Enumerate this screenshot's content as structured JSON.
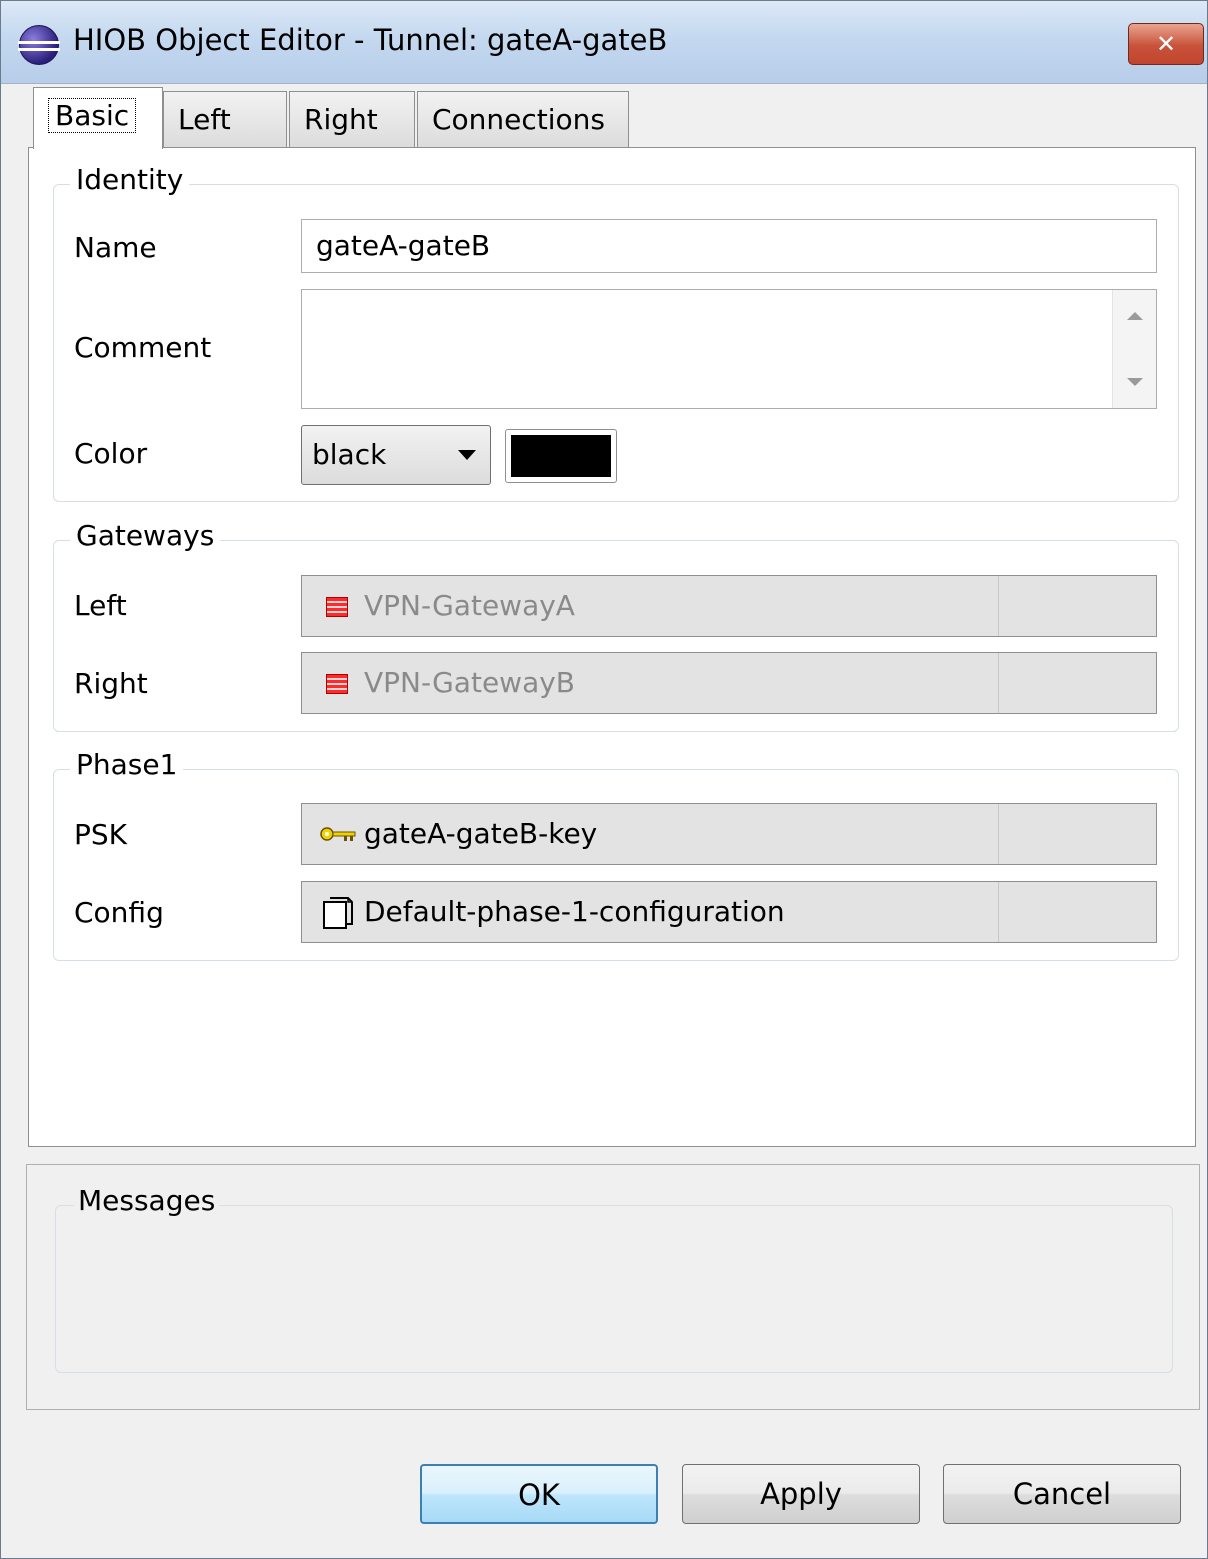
{
  "window": {
    "title": "HIOB Object Editor - Tunnel: gateA-gateB",
    "close_label": "✕"
  },
  "tabs": [
    {
      "label": "Basic",
      "active": true
    },
    {
      "label": "Left"
    },
    {
      "label": "Right"
    },
    {
      "label": "Connections"
    }
  ],
  "identity": {
    "title": "Identity",
    "name_label": "Name",
    "name_value": "gateA-gateB",
    "comment_label": "Comment",
    "comment_value": "",
    "color_label": "Color",
    "color_value": "black",
    "color_swatch": "#000000"
  },
  "gateways": {
    "title": "Gateways",
    "left_label": "Left",
    "left_value": "VPN-GatewayA",
    "right_label": "Right",
    "right_value": "VPN-GatewayB"
  },
  "phase1": {
    "title": "Phase1",
    "psk_label": "PSK",
    "psk_value": "gateA-gateB-key",
    "config_label": "Config",
    "config_value": "Default-phase-1-configuration"
  },
  "messages": {
    "title": "Messages"
  },
  "buttons": {
    "ok": "OK",
    "apply": "Apply",
    "cancel": "Cancel"
  }
}
